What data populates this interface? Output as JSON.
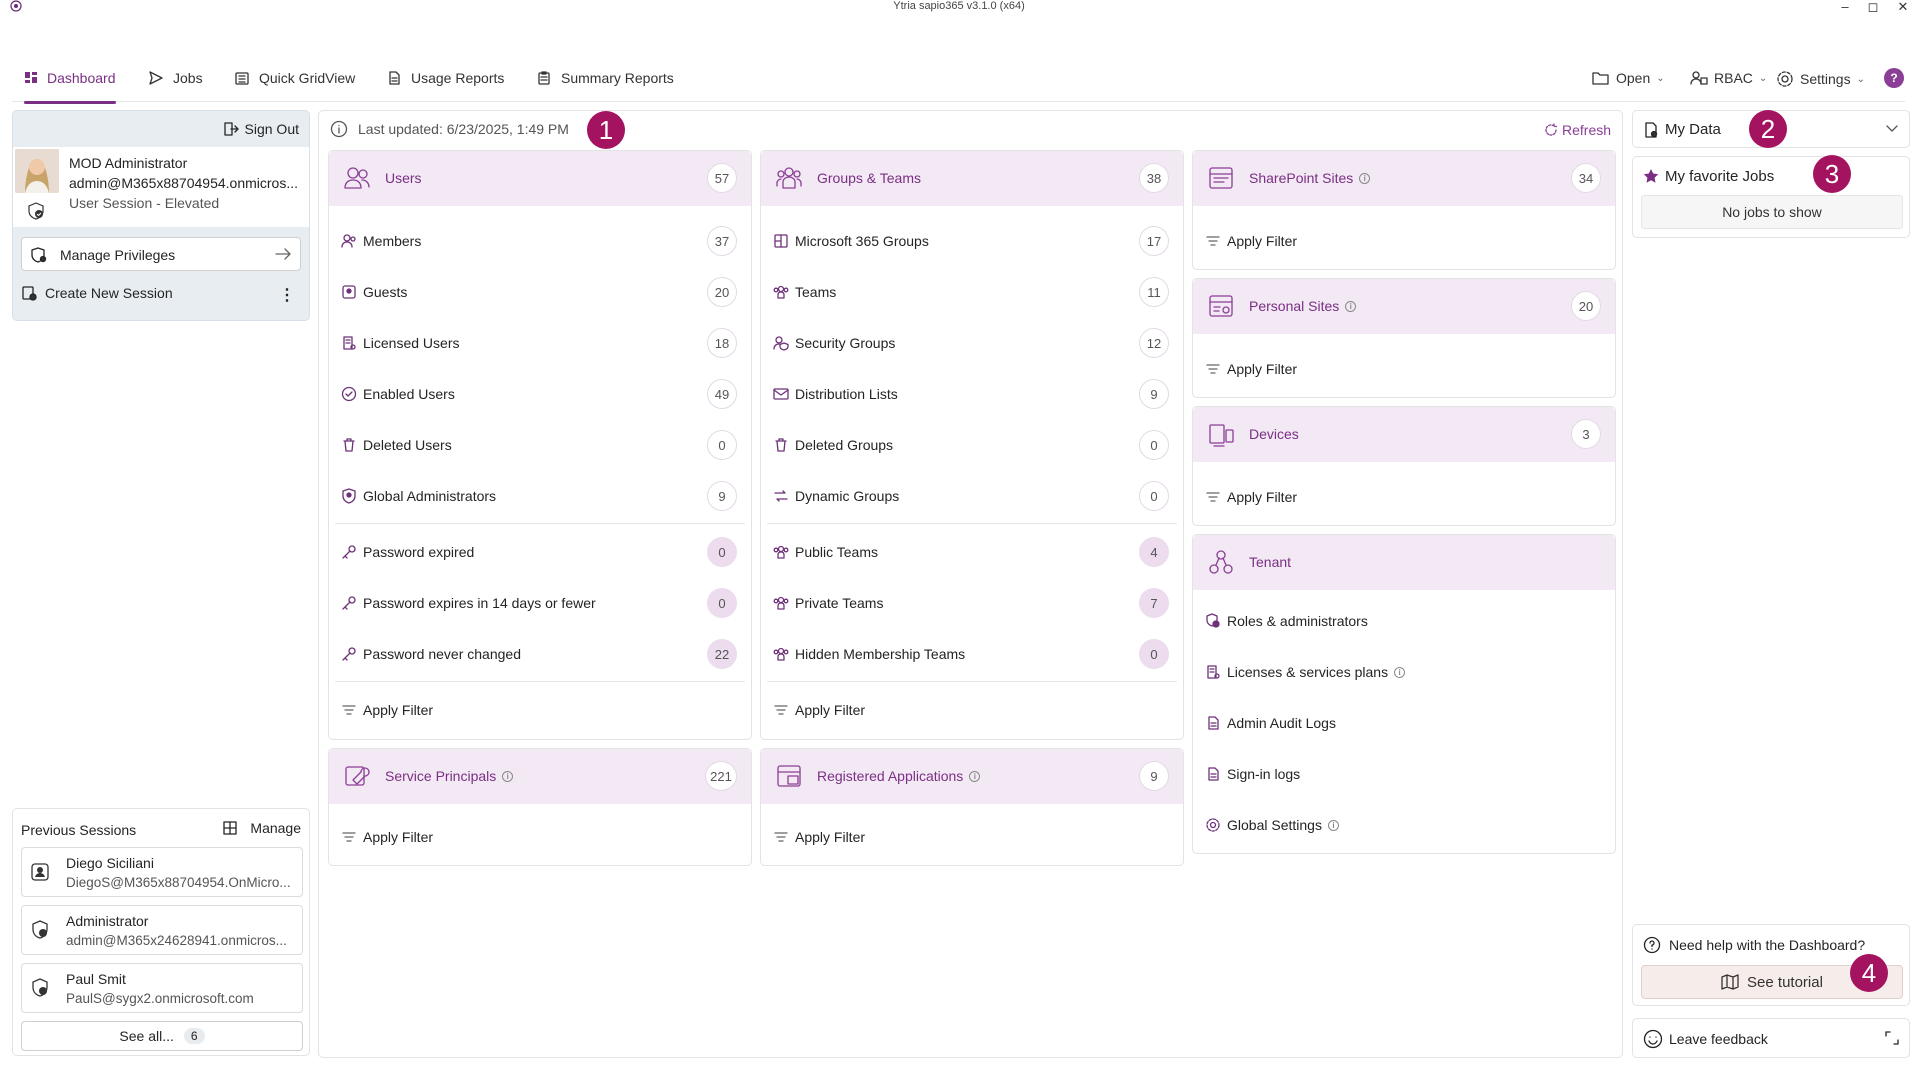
{
  "window": {
    "title": "Ytria sapio365 v3.1.0 (x64)"
  },
  "nav": {
    "tabs": [
      {
        "label": "Dashboard"
      },
      {
        "label": "Jobs"
      },
      {
        "label": "Quick GridView"
      },
      {
        "label": "Usage Reports"
      },
      {
        "label": "Summary Reports"
      }
    ],
    "right": {
      "open": "Open",
      "rbac": "RBAC",
      "settings": "Settings",
      "help": "?"
    }
  },
  "session": {
    "sign_out": "Sign Out",
    "name": "MOD Administrator",
    "email": "admin@M365x88704954.onmicros...",
    "type": "User Session - Elevated",
    "manage_privileges": "Manage Privileges",
    "create_new": "Create New Session"
  },
  "previous": {
    "title": "Previous Sessions",
    "manage": "Manage",
    "items": [
      {
        "name": "Diego Siciliani",
        "email": "DiegoS@M365x88704954.OnMicro..."
      },
      {
        "name": "Administrator",
        "email": "admin@M365x24628941.onmicros..."
      },
      {
        "name": "Paul Smit",
        "email": "PaulS@sygx2.onmicrosoft.com"
      }
    ],
    "see_all": "See all...",
    "see_all_count": "6"
  },
  "status": {
    "last_updated": "Last updated: 6/23/2025, 1:49 PM",
    "refresh": "Refresh"
  },
  "callouts": [
    "1",
    "2",
    "3",
    "4"
  ],
  "users": {
    "title": "Users",
    "count": "57",
    "rows": [
      {
        "label": "Members",
        "count": "37"
      },
      {
        "label": "Guests",
        "count": "20"
      },
      {
        "label": "Licensed Users",
        "count": "18"
      },
      {
        "label": "Enabled Users",
        "count": "49"
      },
      {
        "label": "Deleted Users",
        "count": "0"
      },
      {
        "label": "Global Administrators",
        "count": "9"
      }
    ],
    "rows2": [
      {
        "label": "Password expired",
        "count": "0"
      },
      {
        "label": "Password expires in 14 days or fewer",
        "count": "0"
      },
      {
        "label": "Password never changed",
        "count": "22"
      }
    ],
    "filter": "Apply Filter"
  },
  "groups": {
    "title": "Groups & Teams",
    "count": "38",
    "rows": [
      {
        "label": "Microsoft 365 Groups",
        "count": "17"
      },
      {
        "label": "Teams",
        "count": "11"
      },
      {
        "label": "Security Groups",
        "count": "12"
      },
      {
        "label": "Distribution Lists",
        "count": "9"
      },
      {
        "label": "Deleted Groups",
        "count": "0"
      },
      {
        "label": "Dynamic Groups",
        "count": "0"
      }
    ],
    "rows2": [
      {
        "label": "Public Teams",
        "count": "4"
      },
      {
        "label": "Private Teams",
        "count": "7"
      },
      {
        "label": "Hidden Membership Teams",
        "count": "0"
      }
    ],
    "filter": "Apply Filter"
  },
  "sp": {
    "title": "Service Principals",
    "count": "221",
    "filter": "Apply Filter"
  },
  "apps": {
    "title": "Registered Applications",
    "count": "9",
    "filter": "Apply Filter"
  },
  "sharepoint": {
    "title": "SharePoint Sites",
    "count": "34",
    "filter": "Apply Filter"
  },
  "personal": {
    "title": "Personal Sites",
    "count": "20",
    "filter": "Apply Filter"
  },
  "devices": {
    "title": "Devices",
    "count": "3",
    "filter": "Apply Filter"
  },
  "tenant": {
    "title": "Tenant",
    "rows": [
      {
        "label": "Roles & administrators"
      },
      {
        "label": "Licenses & services plans"
      },
      {
        "label": "Admin Audit Logs"
      },
      {
        "label": "Sign-in logs"
      },
      {
        "label": "Global Settings"
      }
    ]
  },
  "mydata": {
    "title": "My Data"
  },
  "fav": {
    "title": "My favorite Jobs",
    "empty": "No jobs to show"
  },
  "help": {
    "question": "Need help with the Dashboard?",
    "tutorial": "See tutorial"
  },
  "feedback": {
    "label": "Leave feedback"
  },
  "colors": {
    "accent": "#7a2f84",
    "header_bg": "#f3e9f4",
    "callout": "#a4135f"
  }
}
